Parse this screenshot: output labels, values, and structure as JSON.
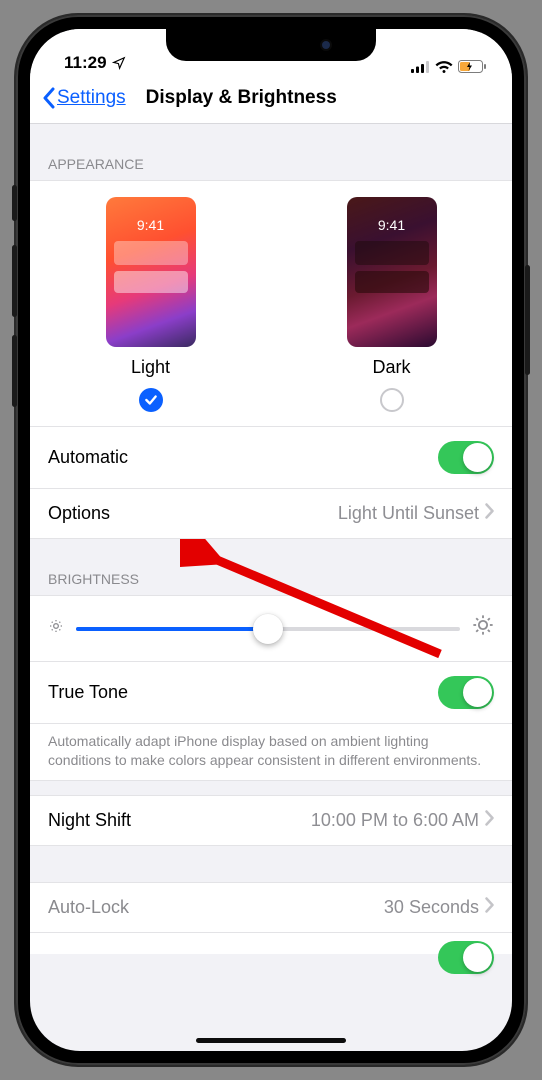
{
  "status": {
    "time": "11:29"
  },
  "nav": {
    "back_label": "Settings",
    "title": "Display & Brightness"
  },
  "appearance": {
    "header": "APPEARANCE",
    "preview_time": "9:41",
    "light_label": "Light",
    "dark_label": "Dark",
    "selected": "light"
  },
  "rows": {
    "automatic_label": "Automatic",
    "automatic_on": true,
    "options_label": "Options",
    "options_value": "Light Until Sunset"
  },
  "brightness": {
    "header": "BRIGHTNESS",
    "level_percent": 50,
    "true_tone_label": "True Tone",
    "true_tone_on": true,
    "footnote": "Automatically adapt iPhone display based on ambient lighting conditions to make colors appear consistent in different environments."
  },
  "night_shift": {
    "label": "Night Shift",
    "value": "10:00 PM to 6:00 AM"
  },
  "auto_lock": {
    "label": "Auto-Lock",
    "value": "30 Seconds"
  }
}
